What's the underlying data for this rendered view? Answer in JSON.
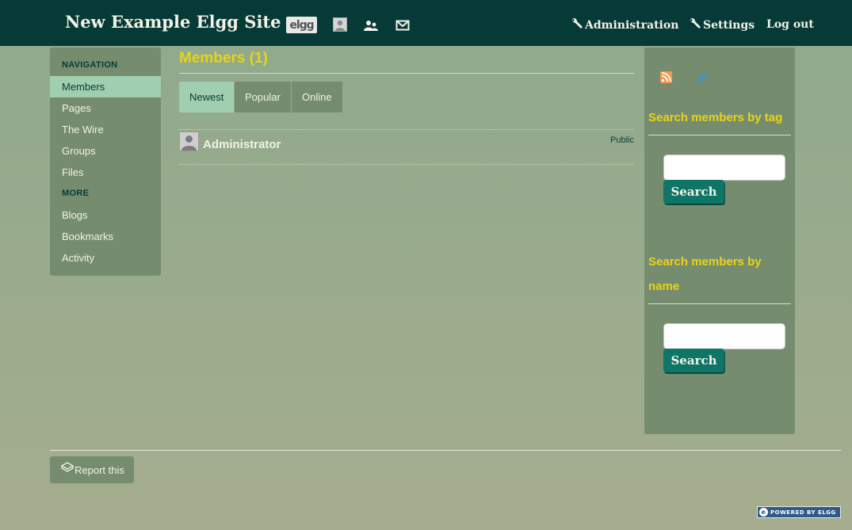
{
  "topbar": {
    "site_title": "New Example Elgg Site",
    "elgg_logo_text": "elgg",
    "icons": [
      "elgg-logo-icon",
      "user-avatar-icon",
      "friends-icon",
      "mail-icon"
    ],
    "administration_label": "Administration",
    "settings_label": "Settings",
    "logout_label": "Log out"
  },
  "nav": {
    "navigation_heading": "NAVIGATION",
    "more_heading": "MORE",
    "items": [
      {
        "label": "Members",
        "active": true
      },
      {
        "label": "Pages"
      },
      {
        "label": "The Wire"
      },
      {
        "label": "Groups"
      },
      {
        "label": "Files"
      }
    ],
    "more_items": [
      {
        "label": "Blogs"
      },
      {
        "label": "Bookmarks"
      },
      {
        "label": "Activity"
      }
    ]
  },
  "main": {
    "title": "Members (1)",
    "tabs": [
      {
        "label": "Newest",
        "active": true
      },
      {
        "label": "Popular"
      },
      {
        "label": "Online"
      }
    ],
    "members": [
      {
        "name": "Administrator",
        "access": "Public"
      }
    ]
  },
  "sidebar": {
    "icons": [
      "rss-icon",
      "pin-icon"
    ],
    "tag_search_heading": "Search members by tag",
    "name_search_heading_line1": "Search members by",
    "name_search_heading_line2": "name",
    "search_button_label": "Search",
    "tag_search_value": "",
    "name_search_value": ""
  },
  "footer": {
    "report_label": "Report this",
    "powered_by": "POWERED BY ELGG",
    "powered_logo_letter": "e"
  },
  "colors": {
    "topbar": "#063a36",
    "panel": "#758d6e",
    "active": "#9fcfb0",
    "heading_yellow": "#e8d31a",
    "button": "#0f7566"
  }
}
